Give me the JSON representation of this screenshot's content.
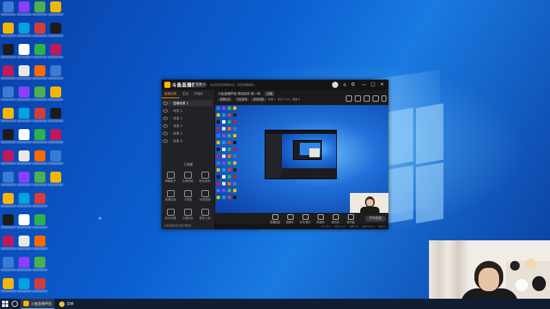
{
  "app": {
    "name": "斗鱼直播伴侣",
    "version_badge": "铂金 ▾",
    "notice": "欢迎您使用直播伴侣，祝您直播顺利。",
    "tabs": [
      "直播场景",
      "互动",
      "开播前"
    ],
    "scenes": [
      "直播场景 1",
      "场景 2",
      "场景 3",
      "场景 4",
      "场景 5",
      "场景 6"
    ],
    "tools_title": "工具箱",
    "tools": [
      "弹幕助手",
      "礼物特效",
      "粉丝勋章",
      "直播回放",
      "小黑屋",
      "房间管理",
      "定时开播",
      "主播任务",
      "更多工具"
    ],
    "footer": "斗鱼直播伴侣使用教程",
    "room": {
      "title": "斗鱼直播伴侣·测试房间 第一场",
      "badge": "开播",
      "chip1": "直播分区",
      "chip2": "主机游戏",
      "chip3": "修改标题",
      "stat1": "在线 0",
      "stat2": "关注 1721",
      "stat3": "热度 0"
    },
    "controls": [
      "直播画面",
      "摄像头",
      "文字/图片",
      "多媒体",
      "麦克风",
      "扬声器"
    ],
    "start_label": "开始直播",
    "status": [
      "CPU 6%",
      "内存 41%",
      "帧率 30",
      "码率 0kb/s",
      "丢帧 0"
    ]
  },
  "window_controls": [
    "⌂",
    "⚙",
    "—",
    "□",
    "✕"
  ],
  "taskbar": {
    "tasks": [
      {
        "label": "斗鱼直播伴侣",
        "active": true
      },
      {
        "label": "剪映",
        "active": false
      }
    ]
  },
  "colors": {
    "accent": "#ff8c1a",
    "desktop": "#0b5fd1",
    "taskbar": "#101d33"
  }
}
